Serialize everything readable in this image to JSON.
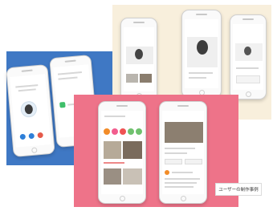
{
  "caption": "ユーザーの制作事例",
  "colors": {
    "blue_panel": "#3f78c4",
    "cream_panel": "#f8efdc",
    "pink_panel": "#ee7389",
    "button_blue": "#2e7fd8",
    "button_red": "#e55a4a",
    "app_green": "#3fbf6a",
    "category_orange": "#f28c28",
    "category_pink": "#f25d8e",
    "category_red": "#ef5353",
    "category_green": "#6fc16e"
  },
  "icons": [
    "avatar-icon",
    "chat-icon",
    "person-icon",
    "message-icon",
    "category-icon"
  ]
}
